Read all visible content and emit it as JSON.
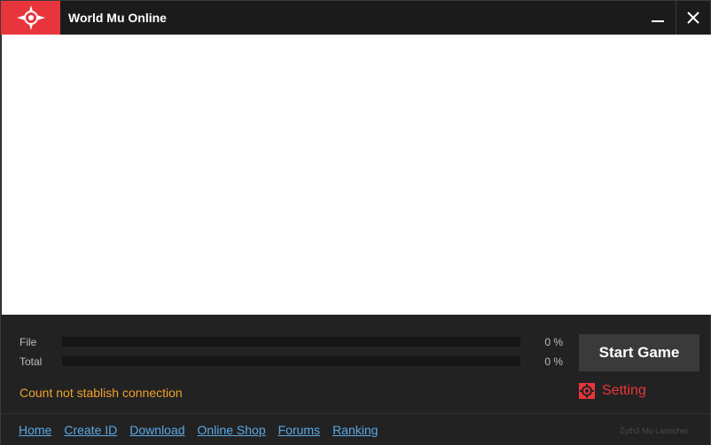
{
  "window": {
    "title": "World Mu Online",
    "logo_icon": "compass-star-logo",
    "accent_color": "#e8353c",
    "minimize_icon": "minimize-icon",
    "close_icon": "close-icon"
  },
  "progress": {
    "file_label": "File",
    "file_percent_text": "0 %",
    "file_value": 0,
    "total_label": "Total",
    "total_percent_text": "0 %",
    "total_value": 0
  },
  "status": {
    "message": "Count not stablish connection",
    "color": "#f0a12a"
  },
  "actions": {
    "start_label": "Start Game",
    "setting_label": "Setting",
    "setting_icon": "gear-icon"
  },
  "footer": {
    "links": [
      "Home",
      "Create ID",
      "Download",
      "Online Shop",
      "Forums",
      "Ranking"
    ],
    "brand": "Zyth3 Mu Launcher"
  }
}
